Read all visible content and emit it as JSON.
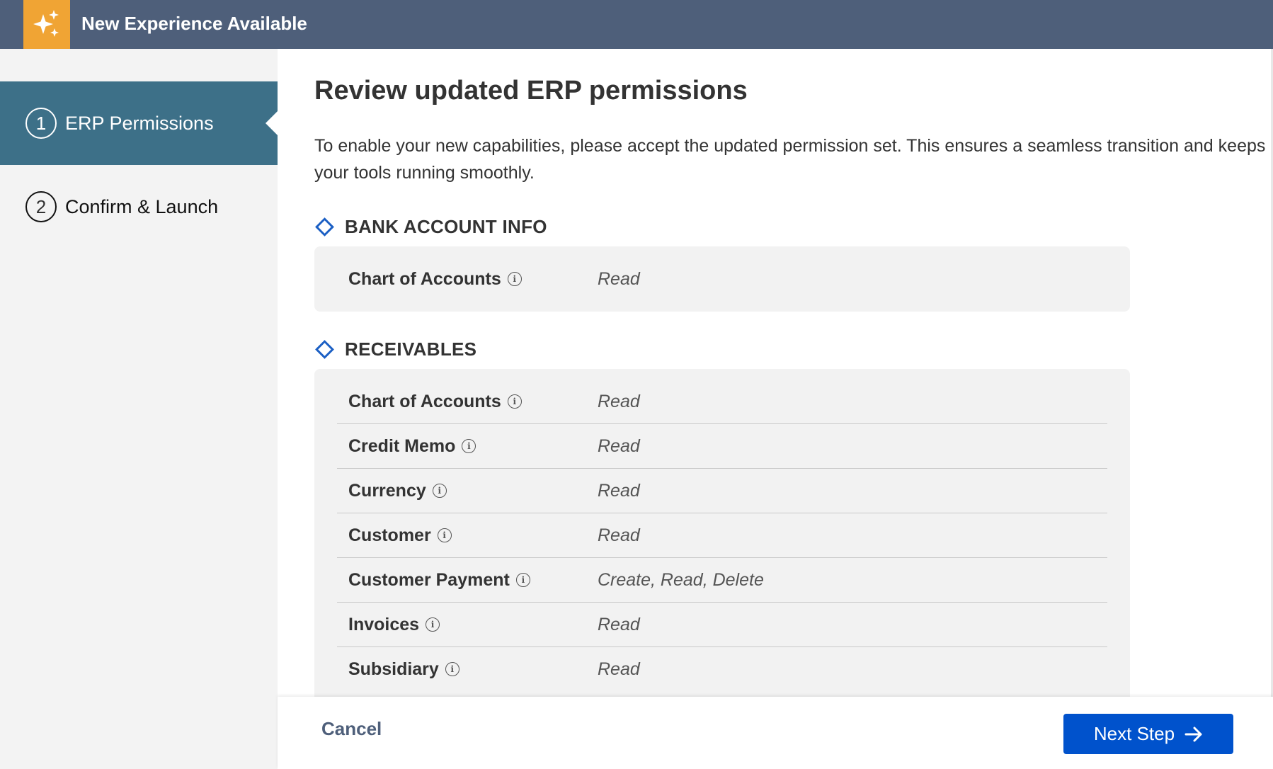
{
  "header": {
    "title": "New Experience Available",
    "badge_icon": "sparkles-icon",
    "badge_color": "#f0a434",
    "bar_color": "#4e5f7a"
  },
  "steps": [
    {
      "number": "1",
      "label": "ERP Permissions",
      "active": true
    },
    {
      "number": "2",
      "label": "Confirm & Launch",
      "active": false
    }
  ],
  "main": {
    "title": "Review updated ERP permissions",
    "description": "To enable your new capabilities, please accept the updated permission set. This ensures a seamless transition and keeps your tools running smoothly.",
    "sections": [
      {
        "title": "BANK ACCOUNT INFO",
        "rows": [
          {
            "name": "Chart of Accounts",
            "value": "Read"
          }
        ]
      },
      {
        "title": "RECEIVABLES",
        "rows": [
          {
            "name": "Chart of Accounts",
            "value": "Read"
          },
          {
            "name": "Credit Memo",
            "value": "Read"
          },
          {
            "name": "Currency",
            "value": "Read"
          },
          {
            "name": "Customer",
            "value": "Read"
          },
          {
            "name": "Customer Payment",
            "value": "Create, Read, Delete"
          },
          {
            "name": "Invoices",
            "value": "Read"
          },
          {
            "name": "Subsidiary",
            "value": "Read"
          }
        ]
      }
    ]
  },
  "footer": {
    "cancel_label": "Cancel",
    "next_label": "Next Step",
    "next_color": "#0052cc"
  }
}
